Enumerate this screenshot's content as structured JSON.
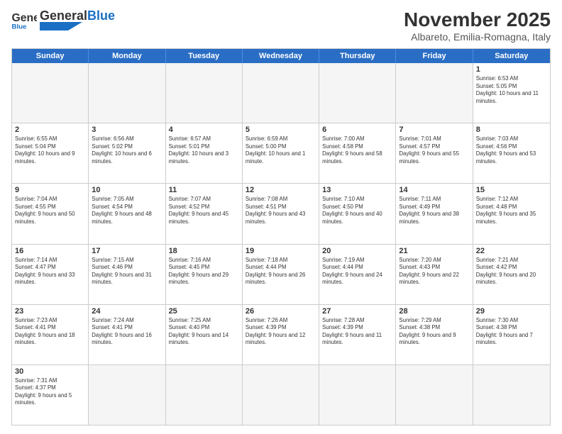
{
  "header": {
    "logo_general": "General",
    "logo_blue": "Blue",
    "month_title": "November 2025",
    "subtitle": "Albareto, Emilia-Romagna, Italy"
  },
  "days_of_week": [
    "Sunday",
    "Monday",
    "Tuesday",
    "Wednesday",
    "Thursday",
    "Friday",
    "Saturday"
  ],
  "weeks": [
    [
      {
        "day": "",
        "info": "",
        "empty": true
      },
      {
        "day": "",
        "info": "",
        "empty": true
      },
      {
        "day": "",
        "info": "",
        "empty": true
      },
      {
        "day": "",
        "info": "",
        "empty": true
      },
      {
        "day": "",
        "info": "",
        "empty": true
      },
      {
        "day": "",
        "info": "",
        "empty": true
      },
      {
        "day": "1",
        "info": "Sunrise: 6:53 AM\nSunset: 5:05 PM\nDaylight: 10 hours and 11 minutes.",
        "empty": false
      }
    ],
    [
      {
        "day": "2",
        "info": "Sunrise: 6:55 AM\nSunset: 5:04 PM\nDaylight: 10 hours and 9 minutes.",
        "empty": false
      },
      {
        "day": "3",
        "info": "Sunrise: 6:56 AM\nSunset: 5:02 PM\nDaylight: 10 hours and 6 minutes.",
        "empty": false
      },
      {
        "day": "4",
        "info": "Sunrise: 6:57 AM\nSunset: 5:01 PM\nDaylight: 10 hours and 3 minutes.",
        "empty": false
      },
      {
        "day": "5",
        "info": "Sunrise: 6:59 AM\nSunset: 5:00 PM\nDaylight: 10 hours and 1 minute.",
        "empty": false
      },
      {
        "day": "6",
        "info": "Sunrise: 7:00 AM\nSunset: 4:58 PM\nDaylight: 9 hours and 58 minutes.",
        "empty": false
      },
      {
        "day": "7",
        "info": "Sunrise: 7:01 AM\nSunset: 4:57 PM\nDaylight: 9 hours and 55 minutes.",
        "empty": false
      },
      {
        "day": "8",
        "info": "Sunrise: 7:03 AM\nSunset: 4:56 PM\nDaylight: 9 hours and 53 minutes.",
        "empty": false
      }
    ],
    [
      {
        "day": "9",
        "info": "Sunrise: 7:04 AM\nSunset: 4:55 PM\nDaylight: 9 hours and 50 minutes.",
        "empty": false
      },
      {
        "day": "10",
        "info": "Sunrise: 7:05 AM\nSunset: 4:54 PM\nDaylight: 9 hours and 48 minutes.",
        "empty": false
      },
      {
        "day": "11",
        "info": "Sunrise: 7:07 AM\nSunset: 4:52 PM\nDaylight: 9 hours and 45 minutes.",
        "empty": false
      },
      {
        "day": "12",
        "info": "Sunrise: 7:08 AM\nSunset: 4:51 PM\nDaylight: 9 hours and 43 minutes.",
        "empty": false
      },
      {
        "day": "13",
        "info": "Sunrise: 7:10 AM\nSunset: 4:50 PM\nDaylight: 9 hours and 40 minutes.",
        "empty": false
      },
      {
        "day": "14",
        "info": "Sunrise: 7:11 AM\nSunset: 4:49 PM\nDaylight: 9 hours and 38 minutes.",
        "empty": false
      },
      {
        "day": "15",
        "info": "Sunrise: 7:12 AM\nSunset: 4:48 PM\nDaylight: 9 hours and 35 minutes.",
        "empty": false
      }
    ],
    [
      {
        "day": "16",
        "info": "Sunrise: 7:14 AM\nSunset: 4:47 PM\nDaylight: 9 hours and 33 minutes.",
        "empty": false
      },
      {
        "day": "17",
        "info": "Sunrise: 7:15 AM\nSunset: 4:46 PM\nDaylight: 9 hours and 31 minutes.",
        "empty": false
      },
      {
        "day": "18",
        "info": "Sunrise: 7:16 AM\nSunset: 4:45 PM\nDaylight: 9 hours and 29 minutes.",
        "empty": false
      },
      {
        "day": "19",
        "info": "Sunrise: 7:18 AM\nSunset: 4:44 PM\nDaylight: 9 hours and 26 minutes.",
        "empty": false
      },
      {
        "day": "20",
        "info": "Sunrise: 7:19 AM\nSunset: 4:44 PM\nDaylight: 9 hours and 24 minutes.",
        "empty": false
      },
      {
        "day": "21",
        "info": "Sunrise: 7:20 AM\nSunset: 4:43 PM\nDaylight: 9 hours and 22 minutes.",
        "empty": false
      },
      {
        "day": "22",
        "info": "Sunrise: 7:21 AM\nSunset: 4:42 PM\nDaylight: 9 hours and 20 minutes.",
        "empty": false
      }
    ],
    [
      {
        "day": "23",
        "info": "Sunrise: 7:23 AM\nSunset: 4:41 PM\nDaylight: 9 hours and 18 minutes.",
        "empty": false
      },
      {
        "day": "24",
        "info": "Sunrise: 7:24 AM\nSunset: 4:41 PM\nDaylight: 9 hours and 16 minutes.",
        "empty": false
      },
      {
        "day": "25",
        "info": "Sunrise: 7:25 AM\nSunset: 4:40 PM\nDaylight: 9 hours and 14 minutes.",
        "empty": false
      },
      {
        "day": "26",
        "info": "Sunrise: 7:26 AM\nSunset: 4:39 PM\nDaylight: 9 hours and 12 minutes.",
        "empty": false
      },
      {
        "day": "27",
        "info": "Sunrise: 7:28 AM\nSunset: 4:39 PM\nDaylight: 9 hours and 11 minutes.",
        "empty": false
      },
      {
        "day": "28",
        "info": "Sunrise: 7:29 AM\nSunset: 4:38 PM\nDaylight: 9 hours and 9 minutes.",
        "empty": false
      },
      {
        "day": "29",
        "info": "Sunrise: 7:30 AM\nSunset: 4:38 PM\nDaylight: 9 hours and 7 minutes.",
        "empty": false
      }
    ],
    [
      {
        "day": "30",
        "info": "Sunrise: 7:31 AM\nSunset: 4:37 PM\nDaylight: 9 hours and 5 minutes.",
        "empty": false
      },
      {
        "day": "",
        "info": "",
        "empty": true
      },
      {
        "day": "",
        "info": "",
        "empty": true
      },
      {
        "day": "",
        "info": "",
        "empty": true
      },
      {
        "day": "",
        "info": "",
        "empty": true
      },
      {
        "day": "",
        "info": "",
        "empty": true
      },
      {
        "day": "",
        "info": "",
        "empty": true
      }
    ]
  ]
}
